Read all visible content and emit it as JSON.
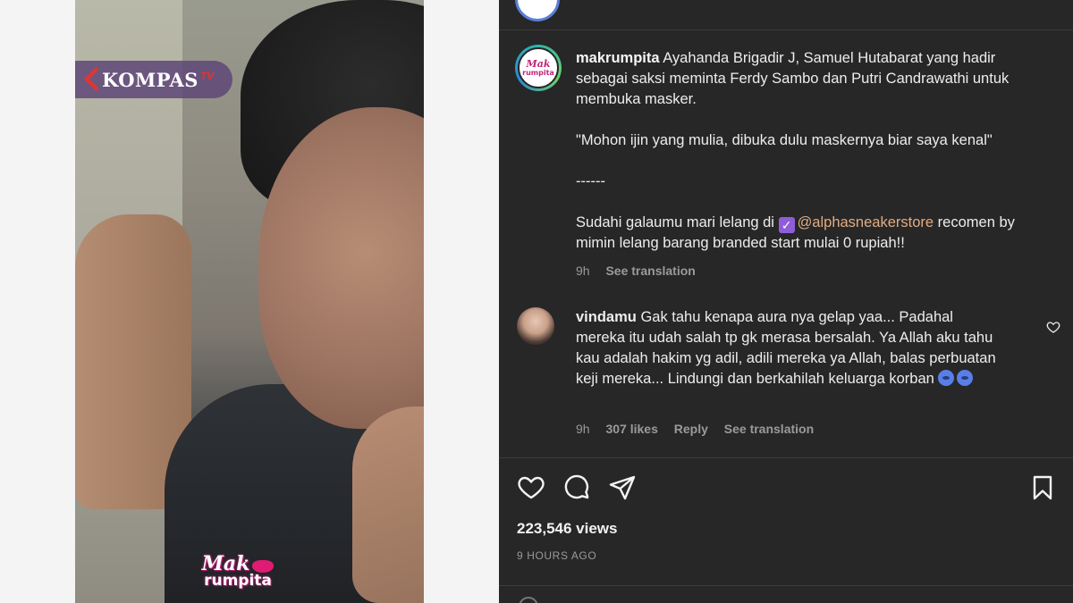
{
  "media": {
    "channel_logo": "KOMPAS",
    "channel_logo_suffix": "TV",
    "watermark_line1": "Mak",
    "watermark_line2": "rumpita"
  },
  "post": {
    "author": "makrumpita",
    "caption_line1": "Ayahanda Brigadir J, Samuel Hutabarat yang hadir sebagai saksi meminta Ferdy Sambo dan Putri Candrawathi untuk membuka masker.",
    "caption_quote": "\"Mohon ijin yang mulia, dibuka dulu maskernya biar saya kenal\"",
    "caption_separator": "------",
    "caption_promo_prefix": "Sudahi galaumu mari lelang di",
    "caption_promo_checkmark": "✓",
    "caption_mention": "@alphasneakerstore",
    "caption_promo_suffix": "recomen by mimin lelang barang branded start mulai 0 rupiah!!",
    "time": "9h",
    "see_translation": "See translation"
  },
  "comment": {
    "author": "vindamu",
    "text": "Gak tahu kenapa aura nya gelap yaa... Padahal mereka itu udah salah tp gk merasa bersalah. Ya Allah aku tahu kau adalah hakim yg adil, adili mereka ya Allah, balas perbuatan keji mereka... Lindungi dan berkahilah keluarga korban",
    "time": "9h",
    "likes": "307 likes",
    "reply": "Reply",
    "see_translation": "See translation"
  },
  "stats": {
    "views": "223,546 views",
    "posted_ago": "9 HOURS AGO"
  },
  "icons": {
    "like": "heart-icon",
    "comment": "comment-icon",
    "share": "send-icon",
    "save": "bookmark-icon",
    "comment_like": "heart-icon"
  },
  "colors": {
    "panel_bg": "#272727",
    "mention": "#e0ab83",
    "muted": "#9a9a9a",
    "brand_pink": "#c0237a",
    "kompas_red": "#e3342f"
  }
}
